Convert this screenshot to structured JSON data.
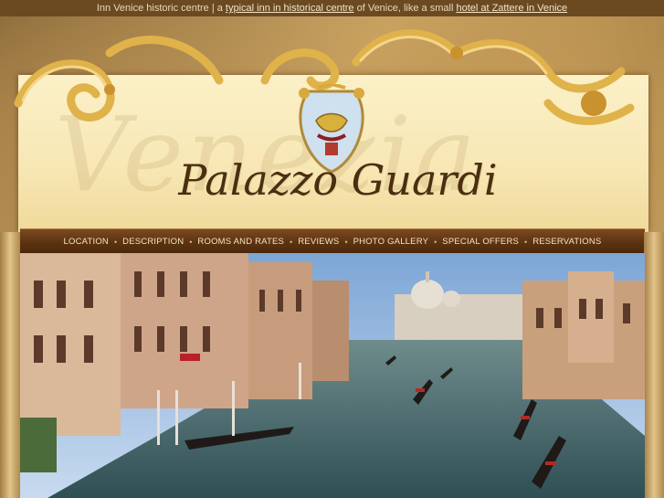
{
  "topbar": {
    "prefix": "Inn Venice historic centre",
    "divider": "|",
    "text1": "a",
    "link1": "typical inn in historical centre",
    "text2": "of Venice, like a small",
    "link2": "hotel at Zattere in Venice"
  },
  "brand": {
    "title": "Palazzo Guardi",
    "watermark": "Venezia"
  },
  "nav": {
    "items": [
      {
        "id": "location",
        "label": "Location"
      },
      {
        "id": "description",
        "label": "Description"
      },
      {
        "id": "rooms",
        "label": "Rooms and Rates"
      },
      {
        "id": "reviews",
        "label": "Reviews"
      },
      {
        "id": "gallery",
        "label": "Photo Gallery"
      },
      {
        "id": "offers",
        "label": "Special Offers"
      },
      {
        "id": "reservations",
        "label": "Reservations"
      }
    ],
    "separator": "•"
  },
  "colors": {
    "nav_bg": "#5b3211",
    "parchment": "#f7e7b4",
    "gold": "#d9a93c",
    "canal": "#3d5f66"
  }
}
